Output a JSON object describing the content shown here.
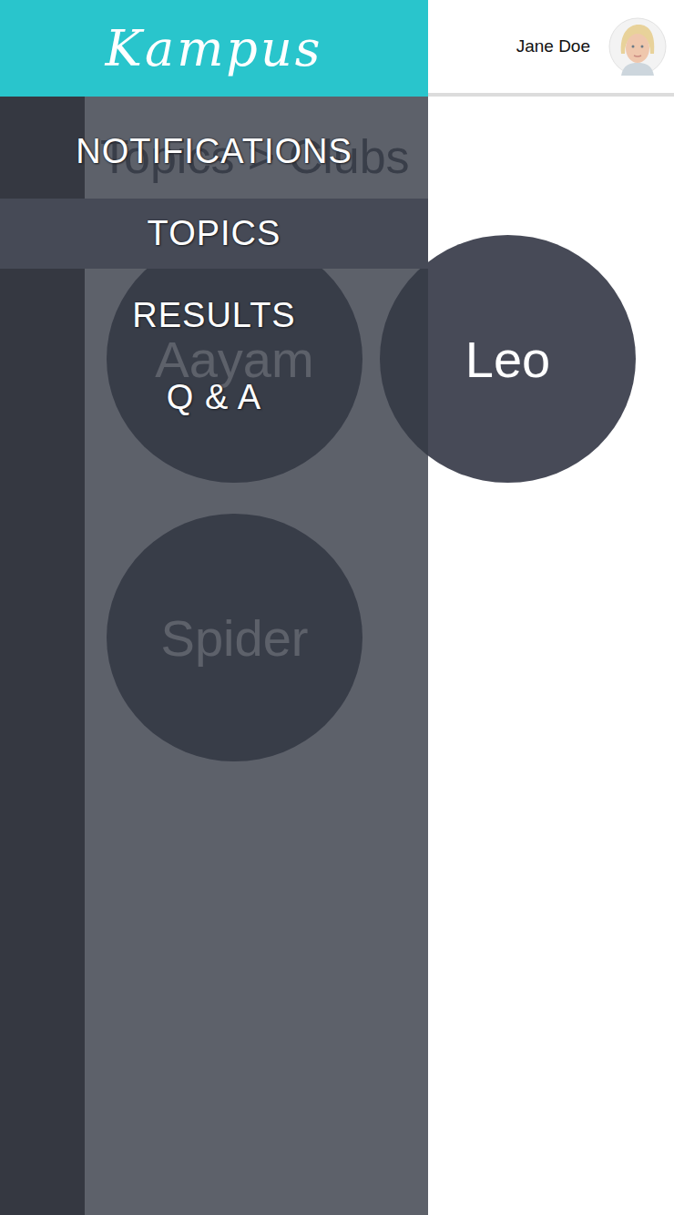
{
  "header": {
    "logo": "Kampus",
    "user": {
      "name": "Jane Doe"
    }
  },
  "breadcrumb": "Topics > Clubs",
  "clubs": [
    {
      "name": "Aayam"
    },
    {
      "name": "Leo"
    },
    {
      "name": "Spider"
    }
  ],
  "drawer": {
    "open": true,
    "items": [
      {
        "label": "NOTIFICATIONS",
        "selected": false
      },
      {
        "label": "TOPICS",
        "selected": true
      },
      {
        "label": "RESULTS",
        "selected": false
      },
      {
        "label": "Q & A",
        "selected": false
      }
    ]
  }
}
